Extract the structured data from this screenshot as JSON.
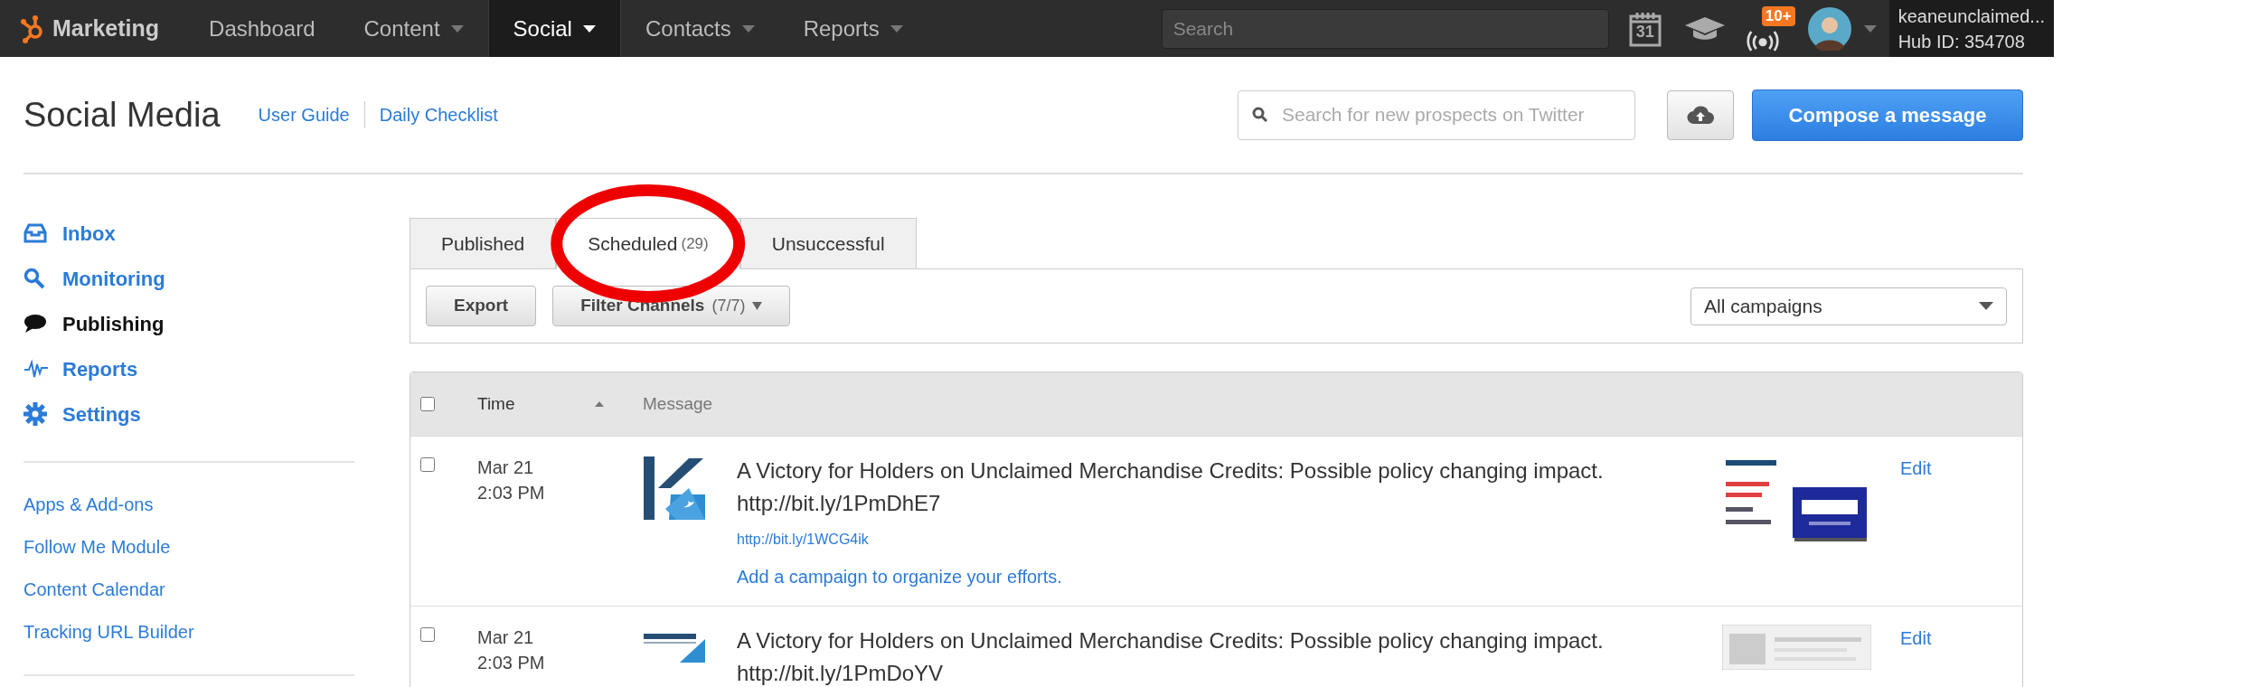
{
  "top_nav": {
    "brand": "Marketing",
    "items": [
      {
        "label": "Dashboard",
        "selected": false,
        "menu": false
      },
      {
        "label": "Content",
        "selected": false,
        "menu": true
      },
      {
        "label": "Social",
        "selected": true,
        "menu": true
      },
      {
        "label": "Contacts",
        "selected": false,
        "menu": true
      },
      {
        "label": "Reports",
        "selected": false,
        "menu": true
      }
    ],
    "search": {
      "placeholder": "Search"
    },
    "calendar_day": "31",
    "notification_badge": "10+",
    "user": {
      "name": "keaneunclaimed...",
      "hub_id": "Hub ID: 354708"
    }
  },
  "header": {
    "title": "Social Media",
    "links": [
      "User Guide",
      "Daily Checklist"
    ],
    "twitter_search": {
      "placeholder": "Search for new prospects on Twitter"
    },
    "compose_button": "Compose a message"
  },
  "sidebar": {
    "items": [
      {
        "label": "Inbox",
        "selected": false
      },
      {
        "label": "Monitoring",
        "selected": false
      },
      {
        "label": "Publishing",
        "selected": true
      },
      {
        "label": "Reports",
        "selected": false
      },
      {
        "label": "Settings",
        "selected": false
      }
    ],
    "links": [
      "Apps & Add-ons",
      "Follow Me Module",
      "Content Calendar",
      "Tracking URL Builder"
    ]
  },
  "tabs": [
    {
      "label": "Published",
      "selected": false,
      "circled": false
    },
    {
      "label": "Scheduled",
      "count": "(29)",
      "selected": true,
      "circled": true
    },
    {
      "label": "Unsuccessful",
      "selected": false,
      "circled": false
    }
  ],
  "toolbar": {
    "export": "Export",
    "filter": {
      "label": "Filter Channels",
      "count": "(7/7)"
    },
    "campaign": "All campaigns"
  },
  "table": {
    "columns": [
      "Time",
      "Message"
    ],
    "select_all": false,
    "rows": [
      {
        "checked": false,
        "date": "Mar 21",
        "time": "2:03 PM",
        "message": "A Victory for Holders on Unclaimed Merchandise Credits: Possible policy changing impact. http://bit.ly/1PmDhE7",
        "link": "http://bit.ly/1WCG4ik",
        "campaign": "Add a campaign to organize your efforts.",
        "action": "Edit"
      },
      {
        "checked": false,
        "date": "Mar 21",
        "time": "2:03 PM",
        "message": "A Victory for Holders on Unclaimed Merchandise Credits: Possible policy changing impact. http://bit.ly/1PmDoYV",
        "action": "Edit"
      }
    ]
  }
}
